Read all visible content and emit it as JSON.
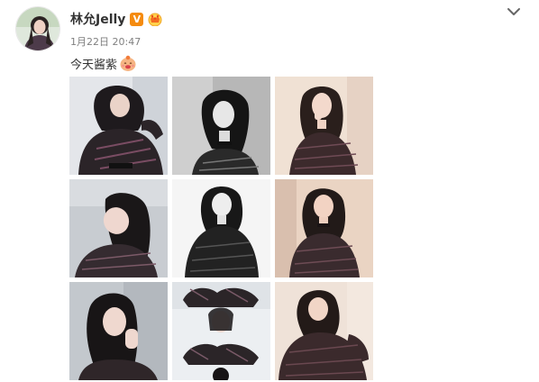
{
  "post": {
    "username": "林允Jelly",
    "verified_badge_text": "V",
    "timestamp": "1月22日 20:47",
    "content_text": "今天酱紫",
    "icons": {
      "avatar": "avatar-photo",
      "verified": "verified-v-icon",
      "member": "crown-member-icon",
      "emoji": "baby-emoji-icon",
      "menu": "chevron-down-icon"
    },
    "photo_count": 9
  },
  "colors": {
    "verified_badge": "#f58b0f",
    "username": "#333333",
    "meta": "#808080",
    "chevron": "#666666"
  }
}
